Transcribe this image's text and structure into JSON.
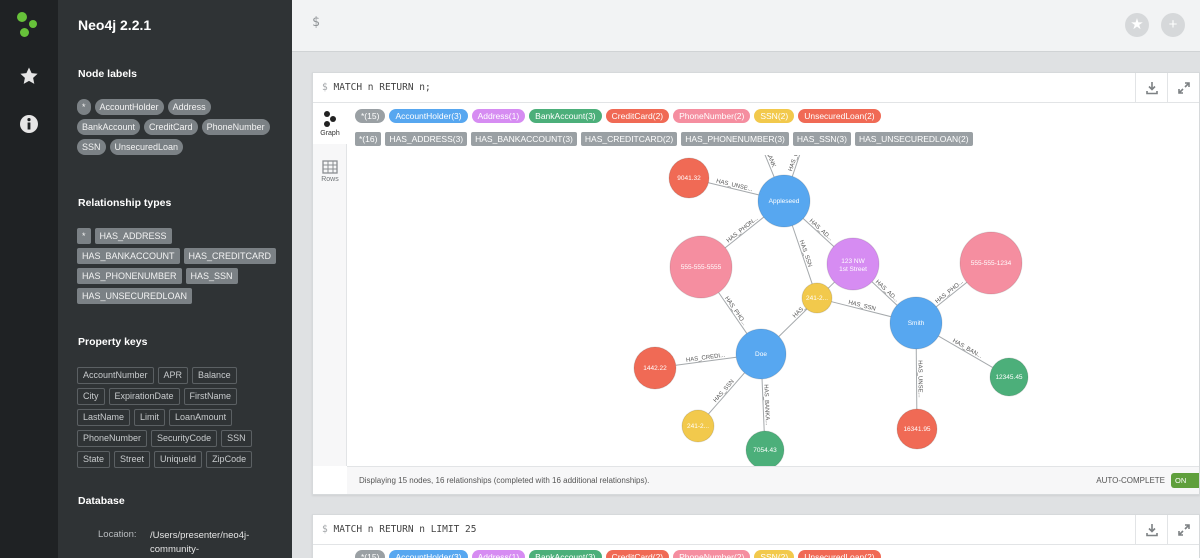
{
  "app": {
    "title": "Neo4j 2.2.1"
  },
  "editor": {
    "prompt": "$"
  },
  "sidebar": {
    "node_labels_title": "Node labels",
    "node_labels": [
      "*",
      "AccountHolder",
      "Address",
      "BankAccount",
      "CreditCard",
      "PhoneNumber",
      "SSN",
      "UnsecuredLoan"
    ],
    "relationship_types_title": "Relationship types",
    "relationship_types": [
      "*",
      "HAS_ADDRESS",
      "HAS_BANKACCOUNT",
      "HAS_CREDITCARD",
      "HAS_PHONENUMBER",
      "HAS_SSN",
      "HAS_UNSECUREDLOAN"
    ],
    "property_keys_title": "Property keys",
    "property_keys": [
      "AccountNumber",
      "APR",
      "Balance",
      "City",
      "ExpirationDate",
      "FirstName",
      "LastName",
      "Limit",
      "LoanAmount",
      "PhoneNumber",
      "SecurityCode",
      "SSN",
      "State",
      "Street",
      "UniqueId",
      "ZipCode"
    ],
    "database_title": "Database",
    "location_label": "Location:",
    "location_value": "/Users/presenter/neo4j-community-"
  },
  "frame1": {
    "prompt": "$",
    "query": "MATCH n RETURN n;",
    "graph_label": "Graph",
    "rows_label": "Rows",
    "node_legend": [
      {
        "label": "*(15)",
        "color": "#9aa0a4"
      },
      {
        "label": "AccountHolder(3)",
        "color": "#57a7f0"
      },
      {
        "label": "Address(1)",
        "color": "#d68cf2"
      },
      {
        "label": "BankAccount(3)",
        "color": "#4caf7a"
      },
      {
        "label": "CreditCard(2)",
        "color": "#f06a55"
      },
      {
        "label": "PhoneNumber(2)",
        "color": "#f58ea0"
      },
      {
        "label": "SSN(2)",
        "color": "#f2c94c"
      },
      {
        "label": "UnsecuredLoan(2)",
        "color": "#f06a55"
      }
    ],
    "rel_legend": [
      "*(16)",
      "HAS_ADDRESS(3)",
      "HAS_BANKACCOUNT(3)",
      "HAS_CREDITCARD(2)",
      "HAS_PHONENUMBER(3)",
      "HAS_SSN(3)",
      "HAS_UNSECUREDLOAN(2)"
    ],
    "status_text": "Displaying 15 nodes, 16 relationships (completed with 16 additional relationships).",
    "autocomplete_label": "AUTO-COMPLETE",
    "autocomplete_state": "ON"
  },
  "graph": {
    "nodes": [
      {
        "id": "appleseed",
        "label": "Appleseed",
        "color": "#57a7f0"
      },
      {
        "id": "doe",
        "label": "Doe",
        "color": "#57a7f0"
      },
      {
        "id": "smith",
        "label": "Smith",
        "color": "#57a7f0"
      },
      {
        "id": "address",
        "label": "123 NW 1st Street",
        "color": "#d68cf2"
      },
      {
        "id": "ssn1",
        "label": "241-2...",
        "color": "#f2c94c"
      },
      {
        "id": "ssn2",
        "label": "241-2...",
        "color": "#f2c94c"
      },
      {
        "id": "phone1",
        "label": "555-555-5555",
        "color": "#f58ea0"
      },
      {
        "id": "phone2",
        "label": "555-555-1234",
        "color": "#f58ea0"
      },
      {
        "id": "loan1",
        "label": "9041.32",
        "color": "#f06a55"
      },
      {
        "id": "cc1",
        "label": "1442.22",
        "color": "#f06a55"
      },
      {
        "id": "loan2",
        "label": "16341.95",
        "color": "#f06a55"
      },
      {
        "id": "bank1",
        "label": "7054.43",
        "color": "#4caf7a"
      },
      {
        "id": "bank2",
        "label": "12345.45",
        "color": "#4caf7a"
      }
    ],
    "edges": [
      {
        "label": "HAS_UNSE..."
      },
      {
        "label": "HAS_PHON..."
      },
      {
        "label": "HAS_AD..."
      },
      {
        "label": "HAS_SSN"
      },
      {
        "label": "HAS_PHO..."
      },
      {
        "label": "HAS_AD..."
      },
      {
        "label": "HAS_CREDI..."
      },
      {
        "label": "HAS_SSN"
      },
      {
        "label": "HAS_BANKA..."
      },
      {
        "label": "HAS_AD..."
      },
      {
        "label": "HAS_SSN"
      },
      {
        "label": "HAS_PHO..."
      },
      {
        "label": "HAS_BAN..."
      },
      {
        "label": "HAS_UNSE..."
      },
      {
        "label": "BANK"
      },
      {
        "label": "HAS_CR"
      }
    ]
  },
  "frame2": {
    "prompt": "$",
    "query": "MATCH n RETURN n LIMIT 25",
    "node_legend": [
      {
        "label": "*(15)",
        "color": "#9aa0a4"
      },
      {
        "label": "AccountHolder(3)",
        "color": "#57a7f0"
      },
      {
        "label": "Address(1)",
        "color": "#d68cf2"
      },
      {
        "label": "BankAccount(3)",
        "color": "#4caf7a"
      },
      {
        "label": "CreditCard(2)",
        "color": "#f06a55"
      },
      {
        "label": "PhoneNumber(2)",
        "color": "#f58ea0"
      },
      {
        "label": "SSN(2)",
        "color": "#f2c94c"
      },
      {
        "label": "UnsecuredLoan(2)",
        "color": "#f06a55"
      }
    ]
  }
}
